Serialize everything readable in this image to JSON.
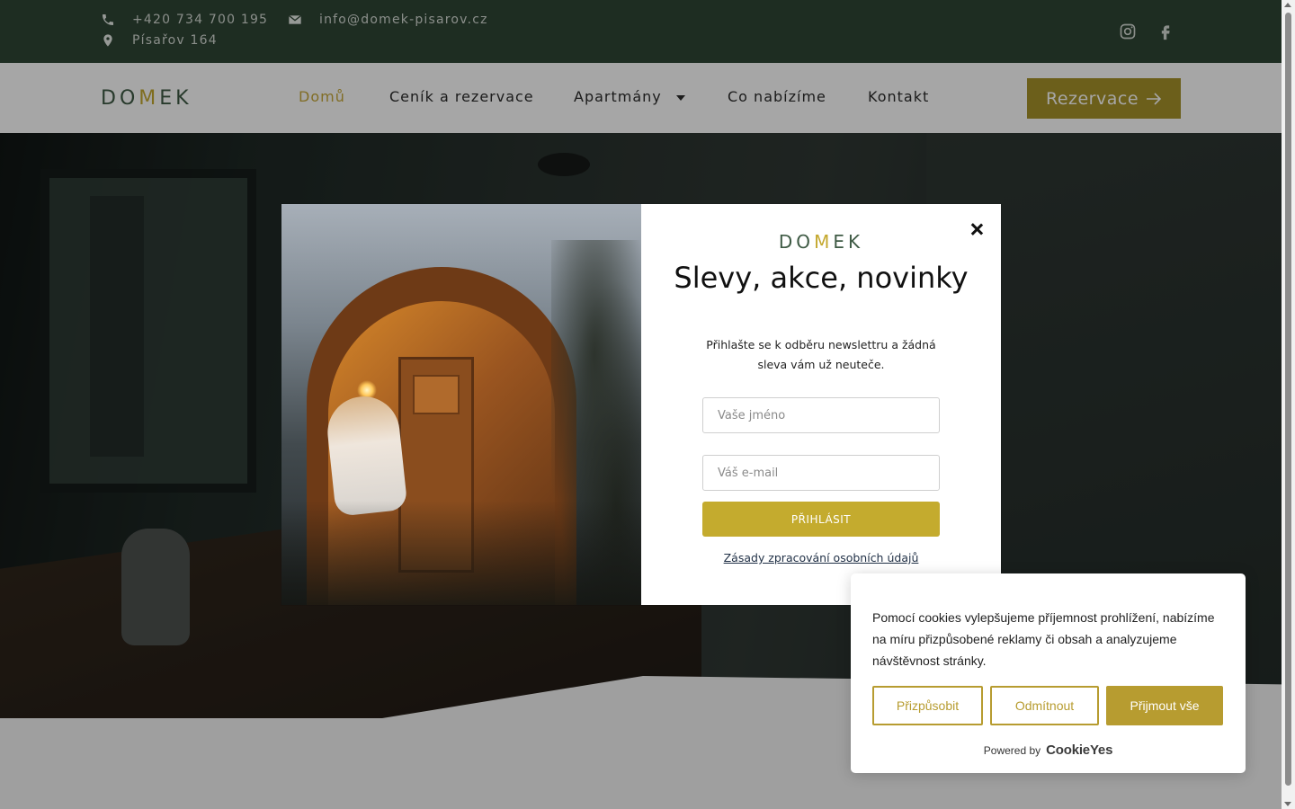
{
  "topbar": {
    "phone": "+420 734 700 195",
    "email": "info@domek-pisarov.cz",
    "address": "Písařov 164",
    "social": [
      "instagram-icon",
      "facebook-icon"
    ]
  },
  "nav": {
    "logo": {
      "prefix": "DO",
      "mark": "M",
      "suffix": "EK"
    },
    "items": [
      {
        "label": "Domů",
        "active": true
      },
      {
        "label": "Ceník a rezervace"
      },
      {
        "label": "Apartmány",
        "dropdown": true
      },
      {
        "label": "Co nabízíme"
      },
      {
        "label": "Kontakt"
      }
    ],
    "cta": "Rezervace"
  },
  "modal": {
    "logo": {
      "prefix": "DO",
      "mark": "M",
      "suffix": "EK"
    },
    "title": "Slevy, akce, novinky",
    "text": "Přihlašte se k odběru newslettru a žádná sleva vám už neuteče.",
    "name_placeholder": "Vaše jméno",
    "email_placeholder": "Váš e-mail",
    "submit": "PŘIHLÁSIT",
    "privacy": "Zásady zpracování osobních údajů"
  },
  "cookie": {
    "text": "Pomocí cookies vylepšujeme příjemnost prohlížení, nabízíme na míru přizpůsobené reklamy či obsah a analyzujeme návštěvnost stránky.",
    "customize": "Přizpůsobit",
    "reject": "Odmítnout",
    "accept": "Přijmout vše",
    "powered": "Powered by",
    "brand": "CookieYes"
  },
  "colors": {
    "topbar": "#2f4535",
    "accent": "#c4ab2e",
    "brand_green": "#3e5a44"
  }
}
